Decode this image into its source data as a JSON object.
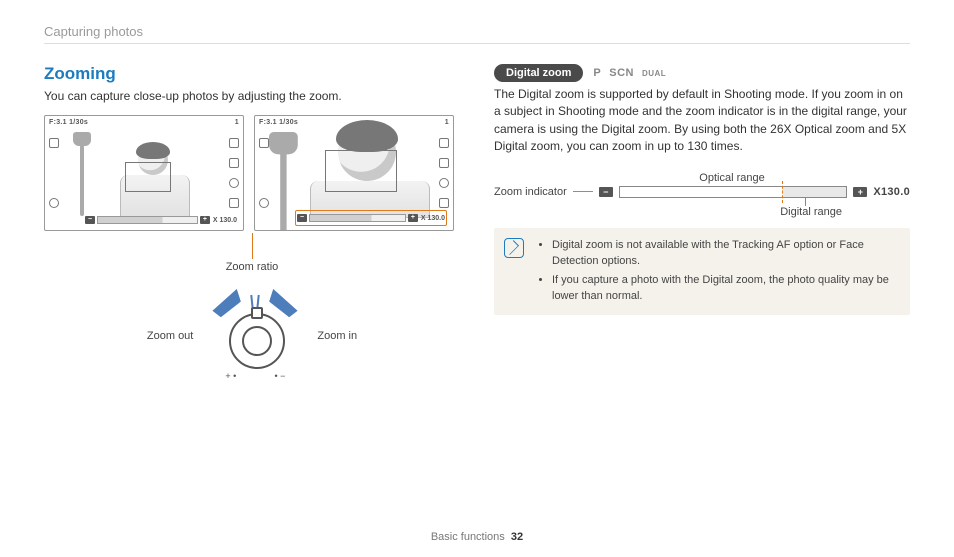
{
  "running_head": "Capturing photos",
  "section_title": "Zooming",
  "intro": "You can capture close-up photos by adjusting the zoom.",
  "lcd": {
    "top_left": "F:3.1  1/30s",
    "top_right": "1",
    "bar_value": "X 130.0"
  },
  "zoom_ratio_label": "Zoom ratio",
  "zoom_out_label": "Zoom out",
  "zoom_in_label": "Zoom in",
  "lever_plus": "+ •",
  "lever_minus": "• −",
  "digital_zoom": {
    "pill": "Digital zoom",
    "mode_p": "P",
    "mode_scn": "SCN",
    "mode_dual": "DUAL",
    "paragraph": "The Digital zoom is supported by default in Shooting mode. If you zoom in on a subject in Shooting mode and the zoom indicator is in the digital range, your camera is using the Digital zoom. By using both the 26X Optical zoom and 5X Digital zoom, you can zoom in up to 130 times.",
    "optical_label": "Optical range",
    "indicator_label": "Zoom indicator",
    "digital_label": "Digital range",
    "value": "X130.0"
  },
  "notes": [
    "Digital zoom is not available with the Tracking AF option or Face Detection options.",
    "If you capture a photo with the Digital zoom, the photo quality may be lower than normal."
  ],
  "footer_section": "Basic functions",
  "footer_page": "32"
}
